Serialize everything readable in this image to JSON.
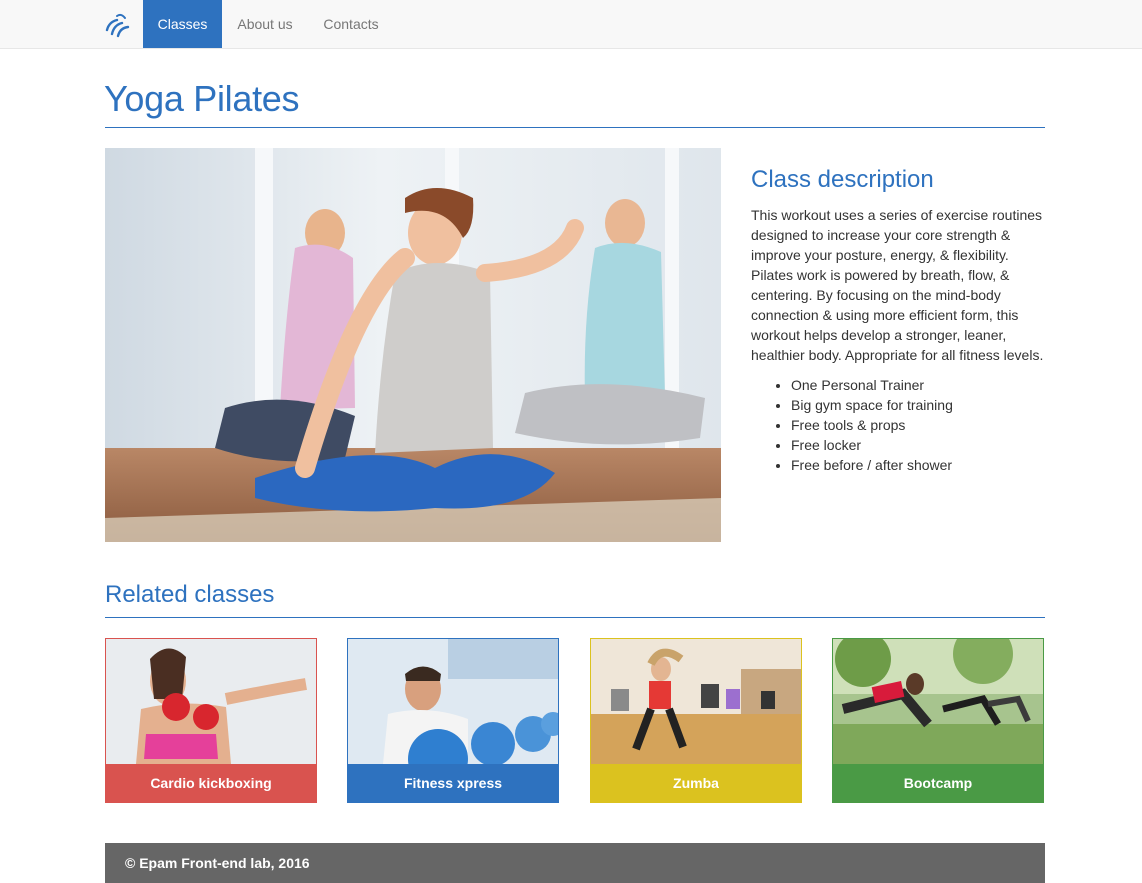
{
  "nav": {
    "logo_icon": "swirl-logo-icon",
    "items": [
      {
        "label": "Classes",
        "active": true
      },
      {
        "label": "About us",
        "active": false
      },
      {
        "label": "Contacts",
        "active": false
      }
    ]
  },
  "page": {
    "title": "Yoga Pilates"
  },
  "description": {
    "heading": "Class description",
    "text": "This workout uses a series of exercise routines designed to increase your core strength & improve your posture, energy, & flexibility. Pilates work is powered by breath, flow, & centering. By focusing on the mind-body connection & using more efficient form, this workout helps develop a stronger, leaner, healthier body. Appropriate for all fitness levels.",
    "features": [
      "One Personal Trainer",
      "Big gym space for training",
      "Free tools & props",
      "Free locker",
      "Free before / after shower"
    ]
  },
  "related": {
    "heading": "Related classes",
    "cards": [
      {
        "label": "Cardio kickboxing",
        "color": "#d9534f"
      },
      {
        "label": "Fitness xpress",
        "color": "#2e72bf"
      },
      {
        "label": "Zumba",
        "color": "#dbc21f"
      },
      {
        "label": "Bootcamp",
        "color": "#4a9a45"
      }
    ]
  },
  "footer": {
    "text": "© Epam Front-end lab, 2016"
  },
  "colors": {
    "accent": "#2e72bf",
    "navbar_bg": "#f8f8f8",
    "footer_bg": "#666666"
  }
}
